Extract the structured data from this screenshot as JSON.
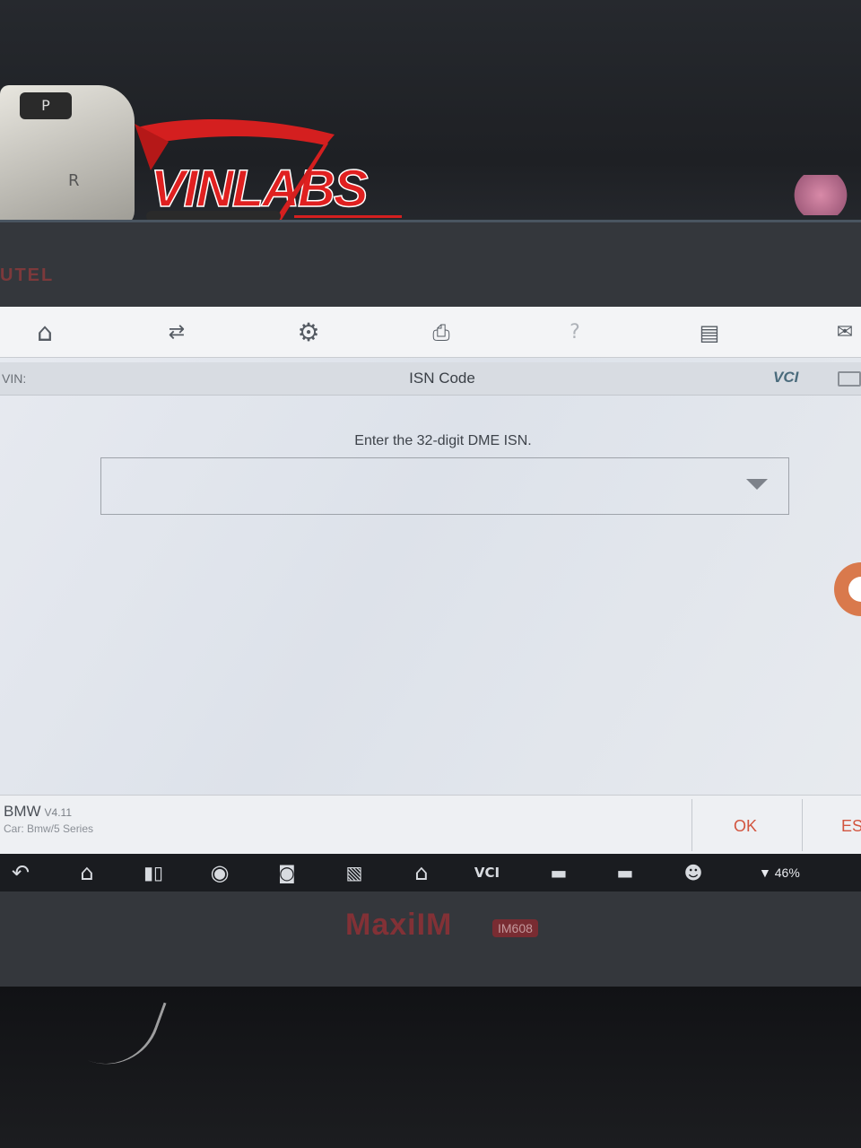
{
  "watermark": {
    "brand": "VINLABS"
  },
  "device": {
    "brand_label": "UTEL",
    "model": "MaxiIM",
    "model_badge": "IM608"
  },
  "toolbar": {
    "icons": [
      "home-icon",
      "car-swap-icon",
      "settings-icon",
      "print-icon",
      "help-icon",
      "save-icon",
      "chat-icon"
    ]
  },
  "infobar": {
    "vin_label": "VIN:",
    "title": "ISN Code",
    "vci_label": "VCI",
    "battery_icon": "battery-icon"
  },
  "main": {
    "prompt": "Enter the 32-digit DME ISN.",
    "isn_value": "",
    "dropdown_icon": "chevron-down-icon"
  },
  "footer": {
    "make": "BMW",
    "version": "V4.11",
    "car": "Car: Bmw/5 Series",
    "ok_label": "OK",
    "esc_label": "ES"
  },
  "taskbar": {
    "icons": [
      "back-icon",
      "home-icon",
      "recent-apps-icon",
      "chrome-icon",
      "camera-icon",
      "display-icon",
      "home-icon",
      "vci-icon",
      "car-battery-icon",
      "car-icon",
      "remote-expert-icon"
    ],
    "battery_level": "46%"
  },
  "colors": {
    "accent": "#d2553f",
    "floating_button": "#d9794c",
    "brand_red": "#9c2f35"
  }
}
